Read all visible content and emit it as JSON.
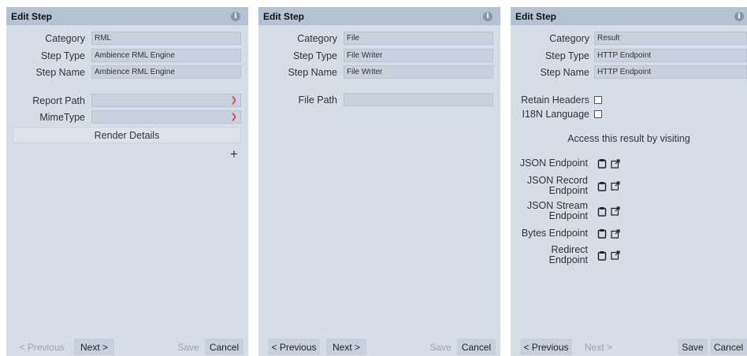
{
  "panels": {
    "rml": {
      "title": "Edit Step",
      "info_icon": "i",
      "category_label": "Category",
      "category_value": "RML",
      "step_type_label": "Step Type",
      "step_type_value": "Ambience RML Engine",
      "step_name_label": "Step Name",
      "step_name_value": "Ambience RML Engine",
      "report_path_label": "Report Path",
      "mime_type_label": "MimeType",
      "render_details_label": "Render Details",
      "add_label": "+",
      "footer": {
        "previous": "< Previous",
        "next": "Next >",
        "save": "Save",
        "cancel": "Cancel"
      }
    },
    "file": {
      "title": "Edit Step",
      "info_icon": "i",
      "category_label": "Category",
      "category_value": "File",
      "step_type_label": "Step Type",
      "step_type_value": "File Writer",
      "step_name_label": "Step Name",
      "step_name_value": "File Writer",
      "file_path_label": "File Path",
      "footer": {
        "previous": "< Previous",
        "next": "Next >",
        "save": "Save",
        "cancel": "Cancel"
      }
    },
    "result": {
      "title": "Edit Step",
      "info_icon": "i",
      "category_label": "Category",
      "category_value": "Result",
      "step_type_label": "Step Type",
      "step_type_value": "HTTP Endpoint",
      "step_name_label": "Step Name",
      "step_name_value": "HTTP Endpoint",
      "retain_headers_label": "Retain Headers",
      "i18n_label": "I18N Language",
      "access_note": "Access this result by visiting",
      "endpoints": [
        {
          "line1": "JSON Endpoint",
          "line2": ""
        },
        {
          "line1": "JSON Record",
          "line2": "Endpoint"
        },
        {
          "line1": "JSON Stream",
          "line2": "Endpoint"
        },
        {
          "line1": "Bytes Endpoint",
          "line2": ""
        },
        {
          "line1": "Redirect",
          "line2": "Endpoint"
        }
      ],
      "footer": {
        "previous": "< Previous",
        "next": "Next >",
        "save": "Save",
        "cancel": "Cancel"
      }
    }
  },
  "colors": {
    "panel_bg": "#d5dde7",
    "header_bg": "#b4c3d3",
    "field_bg": "#c8d2de",
    "caret": "#e04040",
    "disabled_text": "#9aa4ae"
  }
}
